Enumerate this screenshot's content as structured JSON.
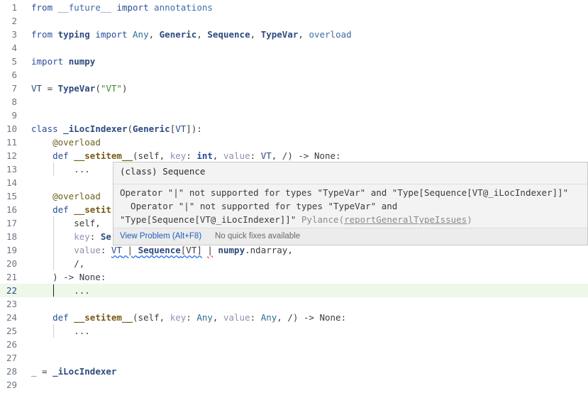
{
  "editor": {
    "lines": [
      {
        "n": "1",
        "tokens": [
          [
            "kw",
            "from"
          ],
          [
            "plain",
            " "
          ],
          [
            "mod",
            "__future__"
          ],
          [
            "plain",
            " "
          ],
          [
            "kw",
            "import"
          ],
          [
            "plain",
            " "
          ],
          [
            "mod",
            "annotations"
          ]
        ]
      },
      {
        "n": "2",
        "tokens": []
      },
      {
        "n": "3",
        "tokens": [
          [
            "kw",
            "from"
          ],
          [
            "plain",
            " "
          ],
          [
            "cls",
            "typing"
          ],
          [
            "plain",
            " "
          ],
          [
            "kw",
            "import"
          ],
          [
            "plain",
            " "
          ],
          [
            "type",
            "Any"
          ],
          [
            "plain",
            ", "
          ],
          [
            "cls",
            "Generic"
          ],
          [
            "plain",
            ", "
          ],
          [
            "cls",
            "Sequence"
          ],
          [
            "plain",
            ", "
          ],
          [
            "cls",
            "TypeVar"
          ],
          [
            "plain",
            ", "
          ],
          [
            "mod",
            "overload"
          ]
        ]
      },
      {
        "n": "4",
        "tokens": []
      },
      {
        "n": "5",
        "tokens": [
          [
            "kw",
            "import"
          ],
          [
            "plain",
            " "
          ],
          [
            "cls",
            "numpy"
          ]
        ]
      },
      {
        "n": "6",
        "tokens": []
      },
      {
        "n": "7",
        "tokens": [
          [
            "var",
            "VT"
          ],
          [
            "plain",
            " = "
          ],
          [
            "cls",
            "TypeVar"
          ],
          [
            "plain",
            "("
          ],
          [
            "str",
            "\"VT\""
          ],
          [
            "plain",
            ")"
          ]
        ]
      },
      {
        "n": "8",
        "tokens": []
      },
      {
        "n": "9",
        "tokens": []
      },
      {
        "n": "10",
        "tokens": [
          [
            "kw",
            "class"
          ],
          [
            "plain",
            " "
          ],
          [
            "cls",
            "_iLocIndexer"
          ],
          [
            "plain",
            "("
          ],
          [
            "cls",
            "Generic"
          ],
          [
            "plain",
            "["
          ],
          [
            "var",
            "VT"
          ],
          [
            "plain",
            "]):"
          ]
        ]
      },
      {
        "n": "11",
        "tokens": [
          [
            "plain",
            "    "
          ],
          [
            "dec",
            "@overload"
          ]
        ]
      },
      {
        "n": "12",
        "tokens": [
          [
            "plain",
            "    "
          ],
          [
            "kw",
            "def"
          ],
          [
            "plain",
            " "
          ],
          [
            "fn",
            "__setitem__"
          ],
          [
            "plain",
            "(self, "
          ],
          [
            "param",
            "key"
          ],
          [
            "plain",
            ": "
          ],
          [
            "builtin",
            "int"
          ],
          [
            "plain",
            ", "
          ],
          [
            "param",
            "value"
          ],
          [
            "plain",
            ": "
          ],
          [
            "var",
            "VT"
          ],
          [
            "plain",
            ", /) -> None:"
          ]
        ]
      },
      {
        "n": "13",
        "tokens": [
          [
            "plain",
            "        ..."
          ]
        ]
      },
      {
        "n": "14",
        "tokens": []
      },
      {
        "n": "15",
        "tokens": [
          [
            "plain",
            "    "
          ],
          [
            "dec",
            "@overload"
          ]
        ]
      },
      {
        "n": "16",
        "tokens": [
          [
            "plain",
            "    "
          ],
          [
            "kw",
            "def"
          ],
          [
            "plain",
            " "
          ],
          [
            "fn",
            "__setit"
          ]
        ]
      },
      {
        "n": "17",
        "tokens": [
          [
            "plain",
            "        self,"
          ]
        ]
      },
      {
        "n": "18",
        "tokens": [
          [
            "plain",
            "        "
          ],
          [
            "param",
            "key"
          ],
          [
            "plain",
            ": "
          ],
          [
            "cls",
            "Se"
          ]
        ]
      },
      {
        "n": "19",
        "tokens": [
          [
            "plain",
            "        "
          ],
          [
            "param",
            "value"
          ],
          [
            "plain",
            ": "
          ],
          [
            "sq-var",
            "VT"
          ],
          [
            "sq-plain",
            " | "
          ],
          [
            "sq-cls",
            "Sequence"
          ],
          [
            "sq-plain",
            "[VT]"
          ],
          [
            "plain",
            " "
          ],
          [
            "sqr-plain",
            "|"
          ],
          [
            "plain",
            " "
          ],
          [
            "cls",
            "numpy"
          ],
          [
            "plain",
            ".ndarray,"
          ]
        ]
      },
      {
        "n": "20",
        "tokens": [
          [
            "plain",
            "        /,"
          ]
        ]
      },
      {
        "n": "21",
        "tokens": [
          [
            "plain",
            "    ) -> None:"
          ]
        ]
      },
      {
        "n": "22",
        "tokens": [
          [
            "plain",
            "        ..."
          ]
        ]
      },
      {
        "n": "23",
        "tokens": []
      },
      {
        "n": "24",
        "tokens": [
          [
            "plain",
            "    "
          ],
          [
            "kw",
            "def"
          ],
          [
            "plain",
            " "
          ],
          [
            "fn",
            "__setitem__"
          ],
          [
            "plain",
            "(self, "
          ],
          [
            "param",
            "key"
          ],
          [
            "plain",
            ": "
          ],
          [
            "type",
            "Any"
          ],
          [
            "plain",
            ", "
          ],
          [
            "param",
            "value"
          ],
          [
            "plain",
            ": "
          ],
          [
            "type",
            "Any"
          ],
          [
            "plain",
            ", /) -> None:"
          ]
        ]
      },
      {
        "n": "25",
        "tokens": [
          [
            "plain",
            "        ..."
          ]
        ]
      },
      {
        "n": "26",
        "tokens": []
      },
      {
        "n": "27",
        "tokens": []
      },
      {
        "n": "28",
        "tokens": [
          [
            "plain",
            "_ = "
          ],
          [
            "cls",
            "_iLocIndexer"
          ]
        ]
      },
      {
        "n": "29",
        "tokens": []
      }
    ],
    "current_line": "22"
  },
  "hover": {
    "signature": "(class) Sequence",
    "message_line1": "Operator \"|\" not supported for types \"TypeVar\" and \"Type[Sequence[VT@_iLocIndexer]]\"",
    "message_line2": "  Operator \"|\" not supported for types \"TypeVar\" and",
    "message_line3": "\"Type[Sequence[VT@_iLocIndexer]]\"",
    "source": "Pylance",
    "rule_code": "reportGeneralTypeIssues",
    "view_problem_label": "View Problem (Alt+F8)",
    "no_fix_label": "No quick fixes available"
  }
}
